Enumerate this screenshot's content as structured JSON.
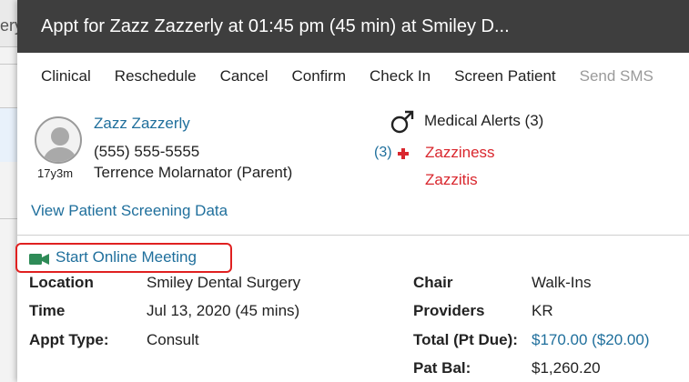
{
  "background_app": {
    "partial_text": "ery"
  },
  "title": "Appt for Zazz Zazzerly at 01:45 pm (45 min) at Smiley D...",
  "actions": [
    {
      "label": "Clinical",
      "enabled": true
    },
    {
      "label": "Reschedule",
      "enabled": true
    },
    {
      "label": "Cancel",
      "enabled": true
    },
    {
      "label": "Confirm",
      "enabled": true
    },
    {
      "label": "Check In",
      "enabled": true
    },
    {
      "label": "Screen Patient",
      "enabled": true
    },
    {
      "label": "Send SMS",
      "enabled": false
    }
  ],
  "patient": {
    "name": "Zazz Zazzerly",
    "phone": "(555) 555-5555",
    "guardian": "Terrence Molarnator (Parent)",
    "age": "17y3m",
    "gender_icon": "male-icon"
  },
  "medical_alerts": {
    "heading": "Medical Alerts (3)",
    "count_label": "(3)",
    "items": [
      "Zazziness",
      "Zazzitis"
    ]
  },
  "screening_link": "View Patient Screening Data",
  "online_meeting": {
    "label": "Start Online Meeting",
    "icon": "video-camera-icon"
  },
  "details_left": [
    {
      "label": "Location",
      "value": "Smiley Dental Surgery"
    },
    {
      "label": "Time",
      "value": "Jul 13, 2020 (45 mins)"
    },
    {
      "label": "Appt Type:",
      "value": "Consult"
    }
  ],
  "details_right": [
    {
      "label": "Chair",
      "value": "Walk-Ins"
    },
    {
      "label": "Providers",
      "value": "KR"
    },
    {
      "label": "Total (Pt Due):",
      "value": "$170.00 ($20.00)"
    },
    {
      "label": "Pat Bal:",
      "value": "$1,260.20"
    }
  ],
  "colors": {
    "title_bar": "#3e3e3e",
    "link": "#1f6f9c",
    "alert": "#d9272e",
    "highlight_box": "#e02020",
    "camera": "#2e8b57"
  }
}
